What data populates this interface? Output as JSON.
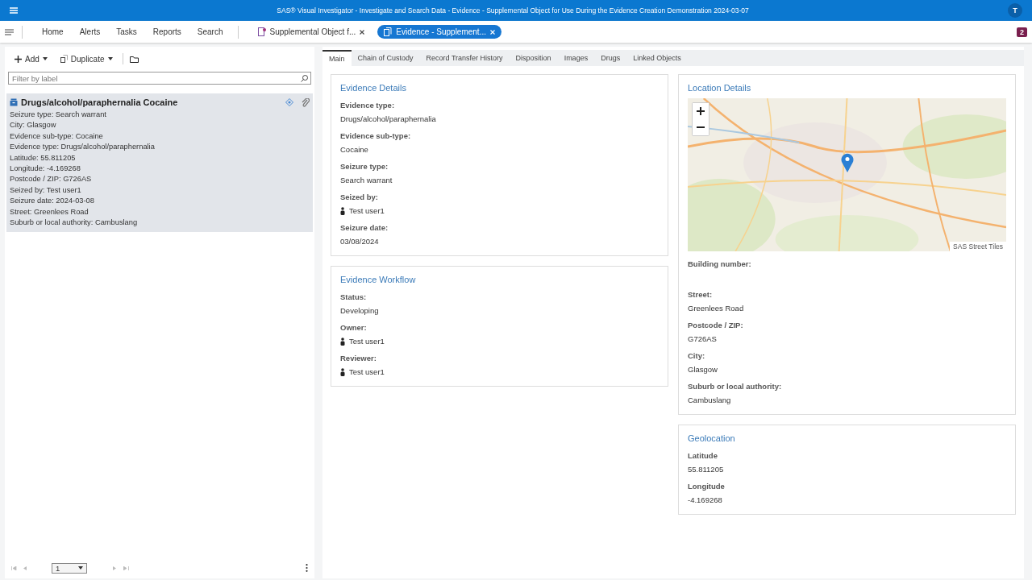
{
  "window": {
    "title": "SAS® Visual Investigator - Investigate and Search Data - Evidence - Supplemental Object for Use During the Evidence Creation Demonstration 2024-03-07",
    "user_initial": "T"
  },
  "nav": {
    "items": [
      "Home",
      "Alerts",
      "Tasks",
      "Reports",
      "Search"
    ],
    "documents": [
      {
        "label": "Supplemental Object f...",
        "selected": false
      },
      {
        "label": "Evidence - Supplement...",
        "selected": true
      }
    ],
    "badge": "2"
  },
  "left_panel": {
    "toolbar": [
      "Add",
      "Duplicate"
    ],
    "filter": {
      "placeholder": "Filter by label"
    },
    "results": [
      {
        "title": "Drugs/alcohol/paraphernalia Cocaine",
        "selected": true,
        "lines": [
          "Seizure type: Search warrant",
          "City: Glasgow",
          "Evidence sub-type: Cocaine",
          "Evidence type: Drugs/alcohol/paraphernalia",
          "Latitude: 55.811205",
          "Longitude: -4.169268",
          "Postcode / ZIP: G726AS",
          "Seized by: Test user1",
          "Seizure date: 2024-03-08",
          "Street: Greenlees Road",
          "Suburb or local authority: Cambuslang"
        ]
      }
    ],
    "pager": {
      "page": "1"
    }
  },
  "tabs": [
    {
      "label": "Main",
      "selected": true
    },
    {
      "label": "Chain of Custody",
      "selected": false
    },
    {
      "label": "Record Transfer History",
      "selected": false
    },
    {
      "label": "Disposition",
      "selected": false
    },
    {
      "label": "Images",
      "selected": false
    },
    {
      "label": "Drugs",
      "selected": false
    },
    {
      "label": "Linked Objects",
      "selected": false
    }
  ],
  "columns": [
    [
      {
        "title": "Evidence Details",
        "fields": [
          {
            "label": "Evidence type:",
            "value": "Drugs/alcohol/paraphernalia",
            "kind": "text"
          },
          {
            "label": "Evidence sub-type:",
            "value": "Cocaine",
            "kind": "text"
          },
          {
            "label": "Seizure type:",
            "value": "Search warrant",
            "kind": "text"
          },
          {
            "label": "Seized by:",
            "value": "Test user1",
            "kind": "user"
          },
          {
            "label": "Seizure date:",
            "value": "03/08/2024",
            "kind": "text"
          }
        ]
      },
      {
        "title": "Evidence Workflow",
        "fields": [
          {
            "label": "Status:",
            "value": "Developing",
            "kind": "text"
          },
          {
            "label": "Owner:",
            "value": "Test user1",
            "kind": "user"
          },
          {
            "label": "Reviewer:",
            "value": "Test user1",
            "kind": "user"
          }
        ]
      }
    ],
    [
      {
        "title": "Location Details",
        "map": {
          "attribution": "SAS Street Tiles"
        },
        "fields": [
          {
            "label": "Building number:"
          },
          {
            "label": "Street:",
            "value": "Greenlees Road",
            "kind": "text"
          },
          {
            "label": "Postcode / ZIP:",
            "value": "G726AS",
            "kind": "text"
          },
          {
            "label": "City:",
            "value": "Glasgow",
            "kind": "text"
          },
          {
            "label": "Suburb or local authority:",
            "value": "Cambuslang",
            "kind": "text"
          }
        ]
      },
      {
        "title": "Geolocation",
        "fields": [
          {
            "label": "Latitude",
            "value": "55.811205",
            "kind": "text"
          },
          {
            "label": "Longitude",
            "value": "-4.169268",
            "kind": "text"
          }
        ]
      }
    ]
  ]
}
